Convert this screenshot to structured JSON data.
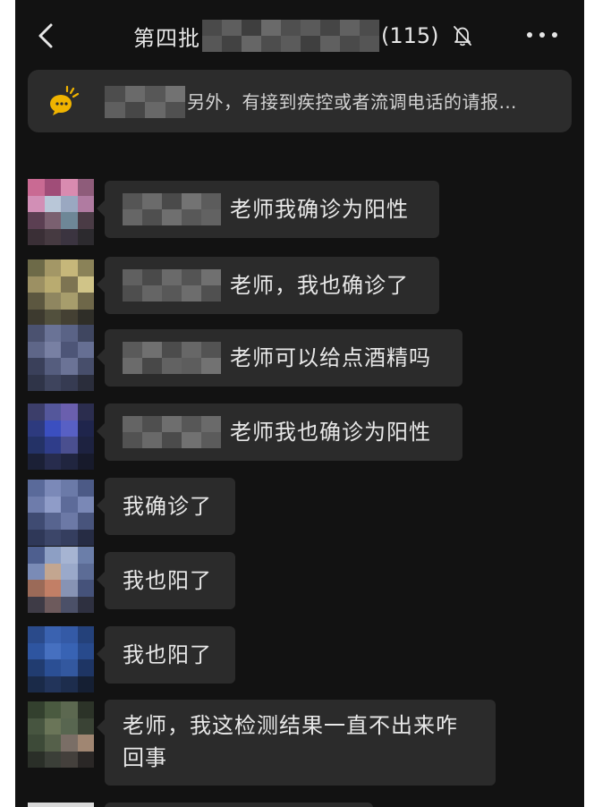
{
  "header": {
    "title_prefix": "第四批",
    "title_count": "(115)",
    "back_icon": "chevron-left-icon",
    "mute_icon": "bell-off-icon",
    "more_icon": "more-dots-icon"
  },
  "notice": {
    "icon": "megaphone-icon",
    "text": "另外，有接到疾控或者流调电话的请报…"
  },
  "messages": [
    {
      "text": "老师我确诊为阳性"
    },
    {
      "text": "老师，我也确诊了"
    },
    {
      "text": "老师可以给点酒精吗"
    },
    {
      "text": "老师我也确诊为阳性"
    },
    {
      "text": "我确诊了"
    },
    {
      "text": "我也阳了"
    },
    {
      "text": "我也阳了"
    },
    {
      "text_line1": "老师，我这检测结果一直不出来咋",
      "text_line2": "回事"
    }
  ],
  "colors": {
    "background": "#121212",
    "bubble": "#2b2b2b",
    "text": "#e8e8e8",
    "notice_bg": "#2c2c2c",
    "notice_icon": "#f0b400"
  }
}
